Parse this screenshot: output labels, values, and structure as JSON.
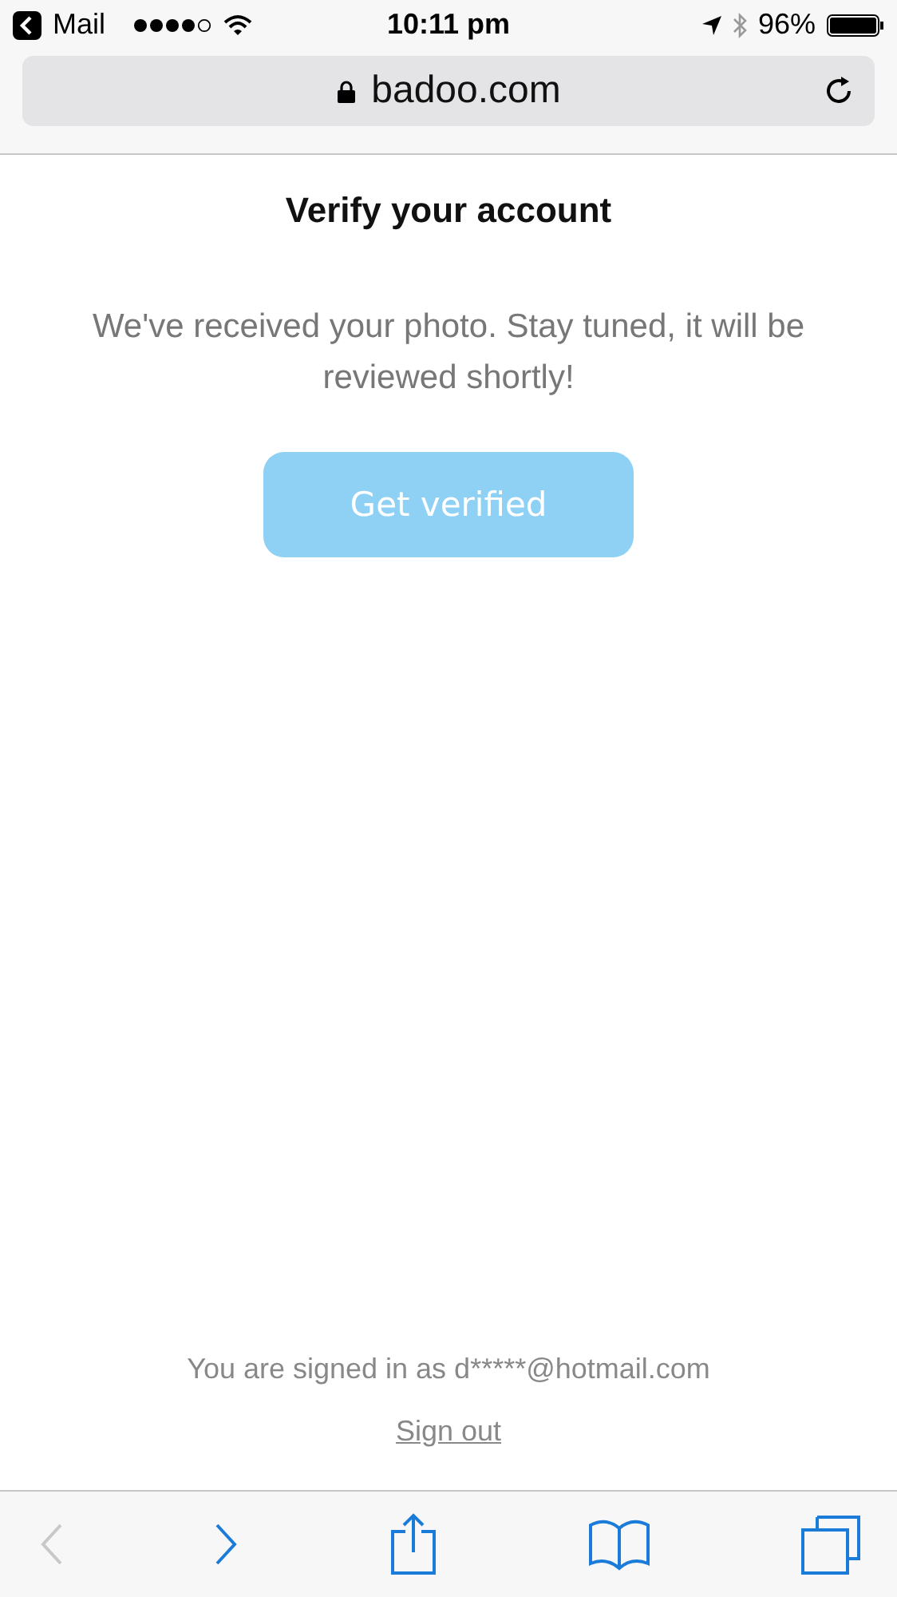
{
  "status_bar": {
    "back_app": "Mail",
    "time": "10:11 pm",
    "battery": "96%"
  },
  "address_bar": {
    "url": "badoo.com"
  },
  "page": {
    "title": "Verify your account",
    "message": "We've received your photo. Stay tuned, it will be reviewed shortly!",
    "button": {
      "label": "Get verified",
      "disabled": true
    },
    "signed_in": "You are signed in as d*****@hotmail.com",
    "sign_out": "Sign out"
  },
  "toolbar": {
    "back": {
      "disabled": true
    },
    "forward": {
      "disabled": false
    }
  }
}
